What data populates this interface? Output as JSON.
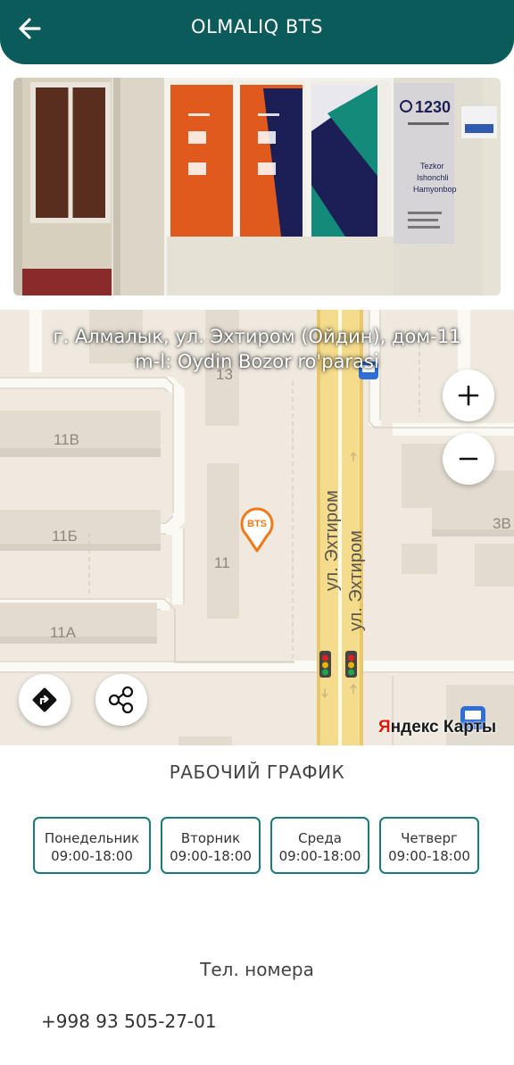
{
  "header": {
    "title": "OLMALIQ BTS",
    "back_icon": "arrow-left-icon",
    "background": "#0b5b5b"
  },
  "photo": {
    "hotline_number": "1230",
    "panel_text": [
      "Tezkor",
      "Ishonchli",
      "Hamyonbop"
    ]
  },
  "map": {
    "address_line1": "г. Алмалык, ул. Эхтиром (Ойдин), дом-11",
    "address_line2": "m-l: Oydin Bozor ro'parasi",
    "labels": {
      "b13": "13",
      "b11v": "11В",
      "b11b": "11Б",
      "b11a": "11А",
      "b11": "11",
      "b3v": "3В",
      "street1": "ул. Эхтиром",
      "street2": "ул. Эхтиром"
    },
    "marker_label": "BTS",
    "marker_color": "#f07a1a",
    "zoom_in_icon": "plus-icon",
    "zoom_out_icon": "minus-icon",
    "route_icon": "route-icon",
    "share_icon": "share-icon",
    "provider_ya": "Я",
    "provider_rest": "ндекс Карты"
  },
  "schedule": {
    "title": "РАБОЧИЙ ГРАФИК",
    "days": [
      {
        "day": "Понедельник",
        "hours": "09:00-18:00"
      },
      {
        "day": "Вторник",
        "hours": "09:00-18:00"
      },
      {
        "day": "Среда",
        "hours": "09:00-18:00"
      },
      {
        "day": "Четверг",
        "hours": "09:00-18:00"
      }
    ],
    "border_color": "#1a7a7a"
  },
  "contacts": {
    "title": "Тел. номера",
    "phones": [
      "+998 93 505-27-01"
    ]
  }
}
